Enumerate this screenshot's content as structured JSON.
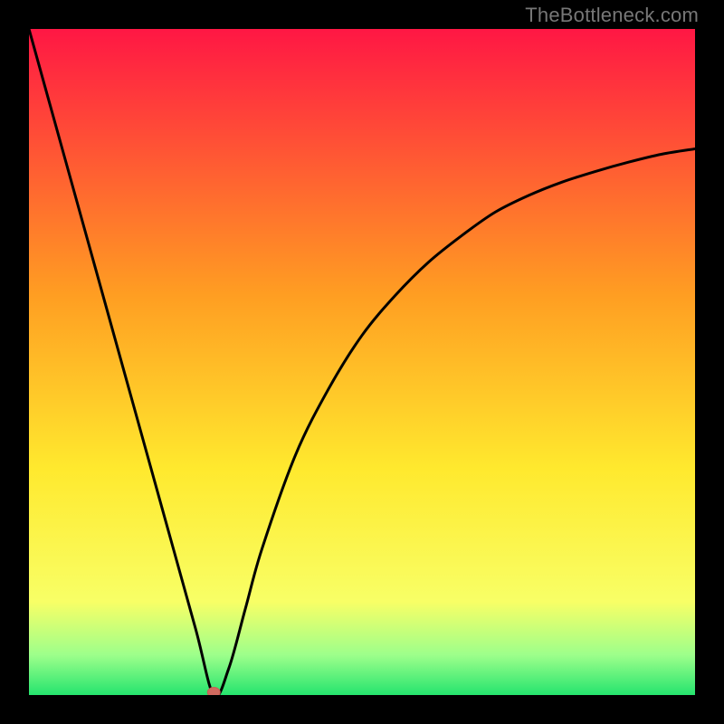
{
  "watermark": "TheBottleneck.com",
  "colors": {
    "frame": "#000000",
    "curve": "#000000",
    "marker_fill": "#d16a5f",
    "marker_stroke": "#c65f54",
    "grad_top": "#ff1744",
    "grad_mid_upper": "#ff9e22",
    "grad_mid": "#ffe92e",
    "grad_lower": "#f8ff66",
    "grad_green_light": "#9dff8b",
    "grad_green": "#25e46e"
  },
  "chart_data": {
    "type": "line",
    "title": "",
    "xlabel": "",
    "ylabel": "",
    "xlim": [
      0,
      1
    ],
    "ylim": [
      0,
      100
    ],
    "series": [
      {
        "name": "bottleneck-curve",
        "x": [
          0.0,
          0.05,
          0.1,
          0.15,
          0.2,
          0.25,
          0.2775,
          0.3,
          0.325,
          0.35,
          0.4,
          0.45,
          0.5,
          0.55,
          0.6,
          0.65,
          0.7,
          0.75,
          0.8,
          0.85,
          0.9,
          0.95,
          1.0
        ],
        "y": [
          100.0,
          82.0,
          64.0,
          46.0,
          28.0,
          10.0,
          0.0,
          4.0,
          13.0,
          22.0,
          36.0,
          46.0,
          54.0,
          60.0,
          65.0,
          69.0,
          72.5,
          75.0,
          77.0,
          78.6,
          80.0,
          81.2,
          82.0
        ]
      }
    ],
    "marker": {
      "x": 0.2775,
      "y": 0.0
    },
    "gradient_stops": [
      {
        "pos": 0.0,
        "color": "#ff1744"
      },
      {
        "pos": 0.4,
        "color": "#ff9e22"
      },
      {
        "pos": 0.66,
        "color": "#ffe92e"
      },
      {
        "pos": 0.86,
        "color": "#f8ff66"
      },
      {
        "pos": 0.94,
        "color": "#9dff8b"
      },
      {
        "pos": 1.0,
        "color": "#25e46e"
      }
    ]
  }
}
